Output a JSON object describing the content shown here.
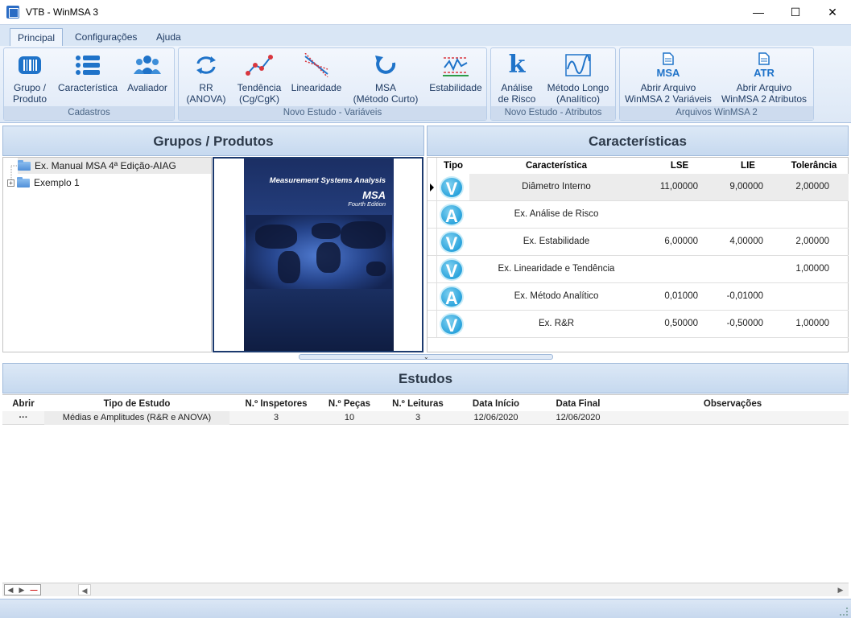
{
  "window": {
    "title": "VTB - WinMSA 3"
  },
  "ribbon": {
    "tabs": [
      "Principal",
      "Configurações",
      "Ajuda"
    ],
    "groups": [
      {
        "label": "Cadastros",
        "buttons": [
          {
            "label": "Grupo /\nProduto",
            "icon": "barcode-icon"
          },
          {
            "label": "Característica",
            "icon": "list-icon"
          },
          {
            "label": "Avaliador",
            "icon": "users-icon"
          }
        ]
      },
      {
        "label": "Novo Estudo - Variáveis",
        "buttons": [
          {
            "label": "RR\n(ANOVA)",
            "icon": "refresh-arrows-icon"
          },
          {
            "label": "Tendência\n(Cg/CgK)",
            "icon": "trend-icon"
          },
          {
            "label": "Linearidade",
            "icon": "linearity-icon"
          },
          {
            "label": "MSA\n(Método Curto)",
            "icon": "undo-arrow-icon"
          },
          {
            "label": "Estabilidade",
            "icon": "stability-chart-icon"
          }
        ]
      },
      {
        "label": "Novo Estudo - Atributos",
        "buttons": [
          {
            "label": "Análise\nde Risco",
            "icon": "k-icon"
          },
          {
            "label": "Método Longo\n(Analítico)",
            "icon": "wave-chart-icon"
          }
        ]
      },
      {
        "label": "Arquivos WinMSA 2",
        "buttons": [
          {
            "label": "Abrir Arquivo\nWinMSA 2 Variáveis",
            "icon": "msa-file-icon",
            "badge": "MSA"
          },
          {
            "label": "Abrir Arquivo\nWinMSA 2 Atributos",
            "icon": "atr-file-icon",
            "badge": "ATR"
          }
        ]
      }
    ]
  },
  "groups_panel": {
    "title": "Grupos / Produtos",
    "tree": [
      "Ex. Manual MSA 4ª Edição-AIAG",
      "Exemplo 1"
    ],
    "book": {
      "line1": "Measurement Systems Analysis",
      "line2": "MSA",
      "line3": "Fourth Edition"
    }
  },
  "characteristics": {
    "title": "Características",
    "columns": [
      "Tipo",
      "Característica",
      "LSE",
      "LIE",
      "Tolerância"
    ],
    "rows": [
      {
        "tipo": "V",
        "name": "Diâmetro Interno",
        "lse": "11,00000",
        "lie": "9,00000",
        "tol": "2,00000"
      },
      {
        "tipo": "A",
        "name": "Ex. Análise de Risco",
        "lse": "",
        "lie": "",
        "tol": ""
      },
      {
        "tipo": "V",
        "name": "Ex. Estabilidade",
        "lse": "6,00000",
        "lie": "4,00000",
        "tol": "2,00000"
      },
      {
        "tipo": "V",
        "name": "Ex. Linearidade e Tendência",
        "lse": "",
        "lie": "",
        "tol": "1,00000"
      },
      {
        "tipo": "A",
        "name": "Ex. Método Analítico",
        "lse": "0,01000",
        "lie": "-0,01000",
        "tol": ""
      },
      {
        "tipo": "V",
        "name": "Ex. R&R",
        "lse": "0,50000",
        "lie": "-0,50000",
        "tol": "1,00000"
      }
    ]
  },
  "studies": {
    "title": "Estudos",
    "columns": [
      "Abrir",
      "Tipo de Estudo",
      "N.º Inspetores",
      "N.º Peças",
      "N.º Leituras",
      "Data Início",
      "Data Final",
      "Observações"
    ],
    "rows": [
      {
        "open": "···",
        "type": "Médias e Amplitudes (R&R e ANOVA)",
        "inspectors": "3",
        "parts": "10",
        "readings": "3",
        "start": "12/06/2020",
        "end": "12/06/2020",
        "notes": ""
      }
    ]
  },
  "colors": {
    "ribbon_bg": "#dde8f6",
    "badge": "#2aa3dc",
    "header_bg": "#c6d9ef"
  }
}
